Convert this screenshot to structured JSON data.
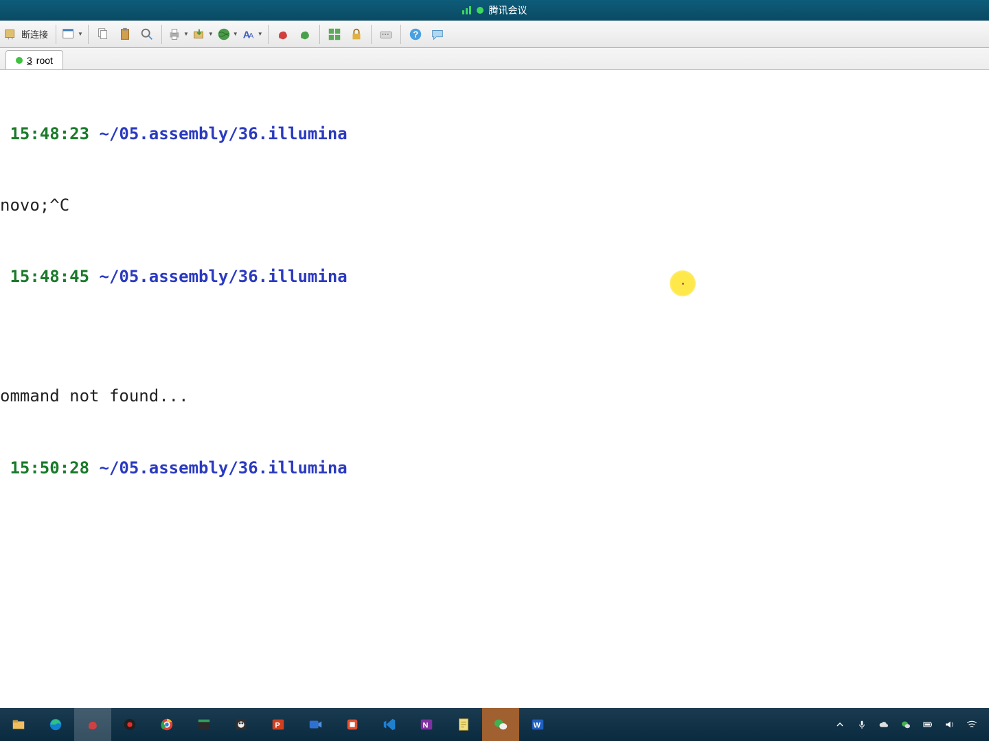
{
  "titlebar": {
    "label": "腾讯会议"
  },
  "toolbar": {
    "connect_label": "断连接"
  },
  "tab": {
    "index": "3",
    "name": "root"
  },
  "terminal": {
    "lines": [
      {
        "ts": " 15:48:23",
        "path": " ~/05.assembly/36.illumina"
      },
      {
        "plain": "novo;^C"
      },
      {
        "ts": " 15:48:45",
        "path": " ~/05.assembly/36.illumina"
      },
      {
        "plain": ""
      },
      {
        "plain": "ommand not found..."
      },
      {
        "ts": " 15:50:28",
        "path": " ~/05.assembly/36.illumina"
      }
    ]
  },
  "icons": {
    "session": "session",
    "copy": "copy",
    "paste": "paste",
    "find": "find",
    "print": "print",
    "transfer": "transfer",
    "globe": "globe",
    "font": "font",
    "red": "macro",
    "green": "script",
    "tile": "tile",
    "lock": "lock",
    "keyboard": "keyboard",
    "help": "help",
    "chat": "chat"
  },
  "taskbar_apps": [
    "files",
    "edge",
    "xshell",
    "record",
    "chrome",
    "term",
    "mobaxterm",
    "powerpoint",
    "meeting",
    "clip",
    "vscode",
    "onenote",
    "notes",
    "wechat",
    "word"
  ]
}
